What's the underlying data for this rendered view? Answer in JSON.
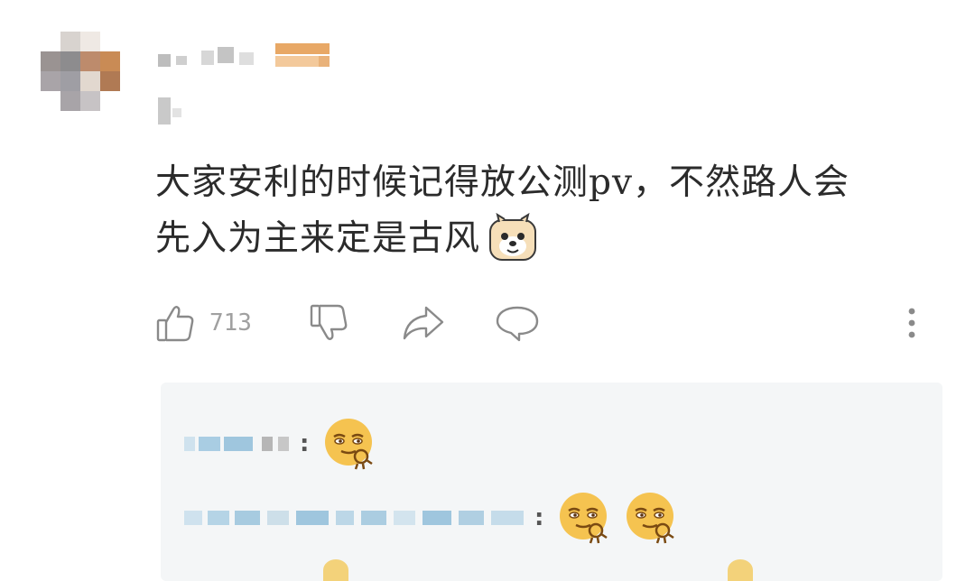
{
  "comment": {
    "line1": "大家安利的时候记得放公测pv，不然路人会",
    "line2": "先入为主来定是古风",
    "emoji": "dog-face-emoji"
  },
  "actions": {
    "like_count": "713",
    "icons": [
      "thumbs-up-icon",
      "thumbs-down-icon",
      "share-arrow-icon",
      "reply-bubble-icon",
      "more-vertical-icon"
    ]
  },
  "replies": {
    "items": [
      {
        "emoji_count": 1,
        "emoji": "ok-hand-smirk-emoji",
        "separator": ":"
      },
      {
        "emoji_count": 2,
        "emoji": "ok-hand-smirk-emoji",
        "separator": ":"
      }
    ]
  },
  "colors": {
    "text": "#2b2b2b",
    "muted": "#a0a0a0",
    "icon": "#8a8a8a",
    "reply_bg": "#f4f6f7",
    "blur_blue": "#9fc6de"
  }
}
